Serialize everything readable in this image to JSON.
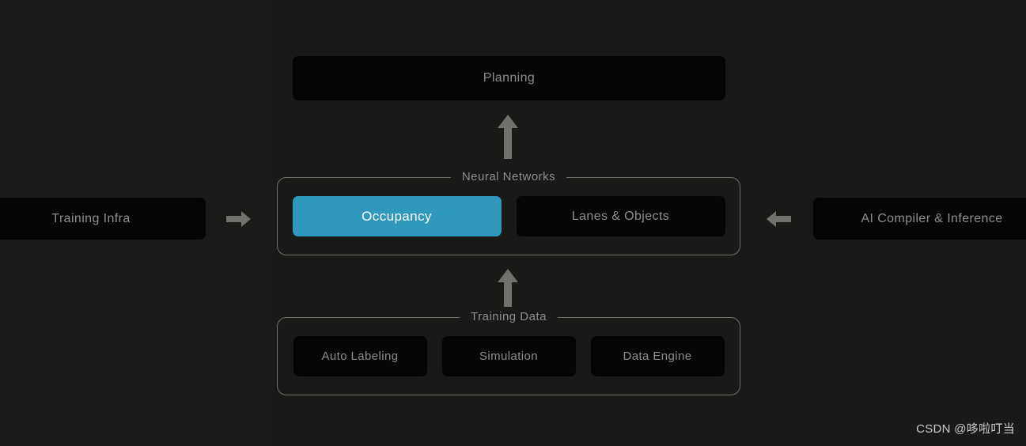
{
  "theme": {
    "background": "#1a1b19",
    "panel_background": "#191a18",
    "block_background": "#050505",
    "block_text": "#8e8e8c",
    "border": "#6d6f6b",
    "accent": "#3098bd",
    "accent_text": "#ffffff",
    "arrow": "#6f716d",
    "watermark_text": "#c9c9c9"
  },
  "diagram": {
    "top": {
      "planning": {
        "label": "Planning"
      }
    },
    "left": {
      "training_infra": {
        "label": "Training Infra"
      },
      "arrow": {
        "icon": "arrow-right-icon",
        "direction": "right"
      }
    },
    "right": {
      "ai_compiler": {
        "label": "AI Compiler & Inference"
      },
      "arrow": {
        "icon": "arrow-left-icon",
        "direction": "left"
      }
    },
    "neural_networks": {
      "legend": "Neural Networks",
      "items": [
        {
          "label": "Occupancy",
          "selected": true
        },
        {
          "label": "Lanes & Objects",
          "selected": false
        }
      ]
    },
    "training_data": {
      "legend": "Training Data",
      "items": [
        {
          "label": "Auto Labeling",
          "selected": false
        },
        {
          "label": "Simulation",
          "selected": false
        },
        {
          "label": "Data Engine",
          "selected": false
        }
      ]
    },
    "connectors": [
      {
        "icon": "arrow-up-icon",
        "from": "Neural Networks",
        "to": "Planning",
        "direction": "up"
      },
      {
        "icon": "arrow-up-icon",
        "from": "Training Data",
        "to": "Neural Networks",
        "direction": "up"
      }
    ]
  },
  "watermark": {
    "text": "CSDN @哆啦叮当"
  }
}
